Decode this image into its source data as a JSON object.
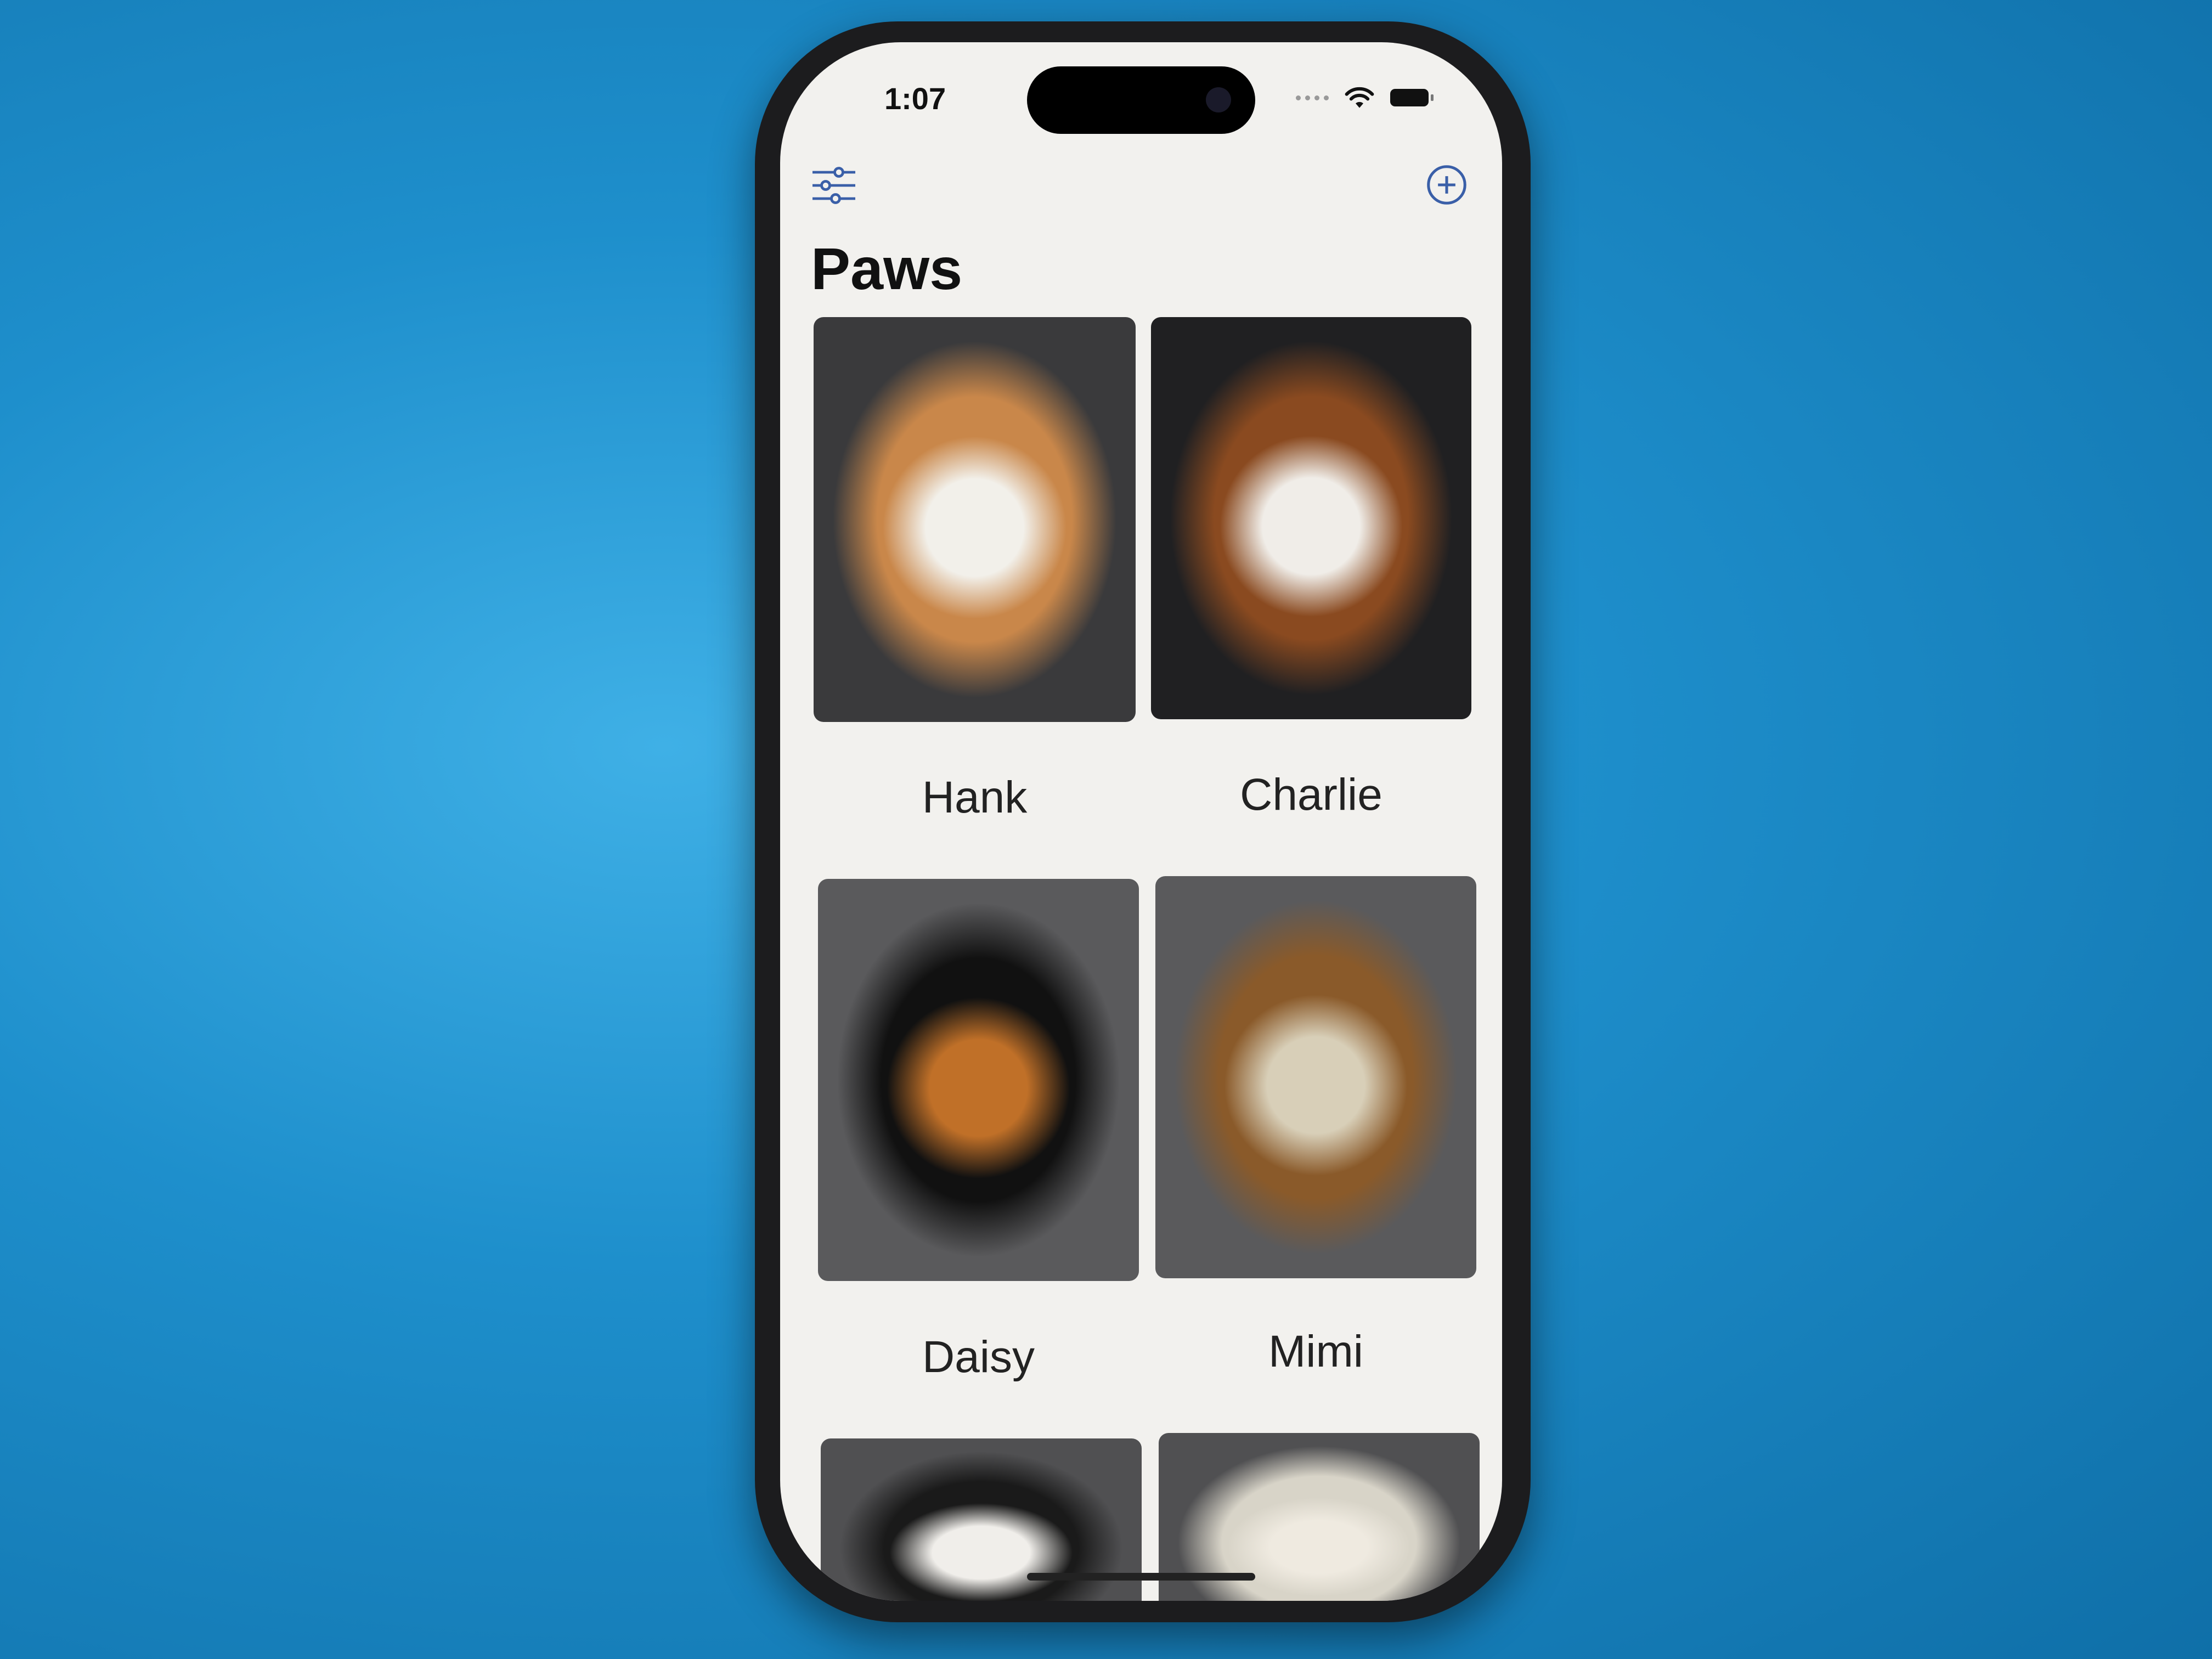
{
  "status_bar": {
    "time": "1:07",
    "wifi_icon": "wifi-icon",
    "battery_icon": "battery-icon"
  },
  "toolbar": {
    "filter_icon": "sliders-icon",
    "add_icon": "plus-circle-icon",
    "accent": "#3a5fa8"
  },
  "title": "Paws",
  "pets": [
    {
      "name": "Hank",
      "colors": [
        "#3a3a3c",
        "#c9874a",
        "#f2f0ea"
      ]
    },
    {
      "name": "Charlie",
      "colors": [
        "#202022",
        "#8a4a20",
        "#f0ede8"
      ]
    },
    {
      "name": "Daisy",
      "colors": [
        "#5a5a5c",
        "#111111",
        "#c07028"
      ]
    },
    {
      "name": "Mimi",
      "colors": [
        "#5a5a5c",
        "#8a5a2a",
        "#d8cfb8"
      ]
    },
    {
      "name": "",
      "colors": [
        "#505052",
        "#1a1a1a",
        "#f0eeea"
      ]
    },
    {
      "name": "",
      "colors": [
        "#505052",
        "#d8d4c8",
        "#efeae0"
      ]
    }
  ]
}
